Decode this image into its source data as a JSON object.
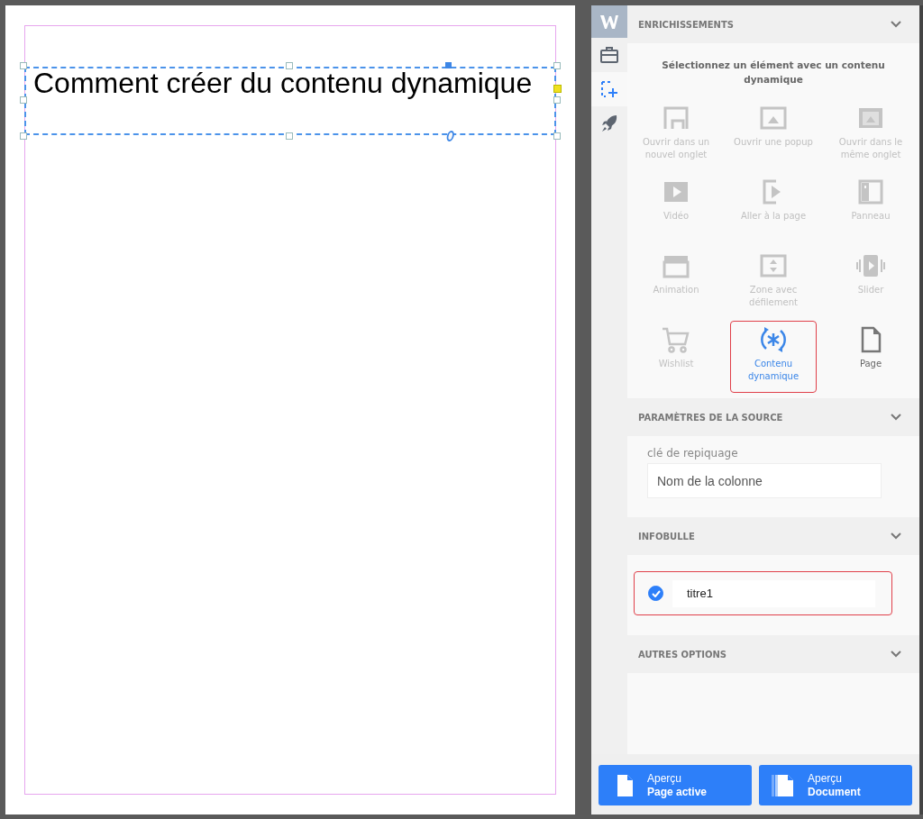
{
  "page": {
    "heading": "Comment créer du contenu dynamique"
  },
  "rail_items": [
    {
      "selected": false
    },
    {
      "selected": true
    },
    {
      "selected": false
    }
  ],
  "enrichments": {
    "title": "ENRICHISSEMENTS",
    "prompt": "Sélectionnez un élément avec un contenu dynamique",
    "items": [
      {
        "label": "Ouvrir dans un nouvel onglet",
        "disabled": true,
        "selected": false
      },
      {
        "label": "Ouvrir une popup",
        "disabled": true,
        "selected": false
      },
      {
        "label": "Ouvrir dans le même onglet",
        "disabled": true,
        "selected": false
      },
      {
        "label": "Vidéo",
        "disabled": true,
        "selected": false
      },
      {
        "label": "Aller à la page",
        "disabled": true,
        "selected": false
      },
      {
        "label": "Panneau",
        "disabled": true,
        "selected": false
      },
      {
        "label": "Animation",
        "disabled": true,
        "selected": false
      },
      {
        "label": "Zone avec défilement",
        "disabled": true,
        "selected": false
      },
      {
        "label": "Slider",
        "disabled": true,
        "selected": false
      },
      {
        "label": "Wishlist",
        "disabled": true,
        "selected": false
      },
      {
        "label": "Contenu dynamique",
        "disabled": false,
        "selected": true
      },
      {
        "label": "Page",
        "disabled": false,
        "selected": false
      }
    ]
  },
  "source": {
    "title": "PARAMÈTRES DE LA SOURCE",
    "field_label": "clé de repiquage",
    "placeholder": "Nom de la colonne"
  },
  "tooltip": {
    "title": "INFOBULLE",
    "checked": true,
    "value": "titre1"
  },
  "other": {
    "title": "AUTRES OPTIONS"
  },
  "preview_buttons": [
    {
      "line1": "Aperçu",
      "line2": "Page active"
    },
    {
      "line1": "Aperçu",
      "line2": "Document"
    }
  ]
}
